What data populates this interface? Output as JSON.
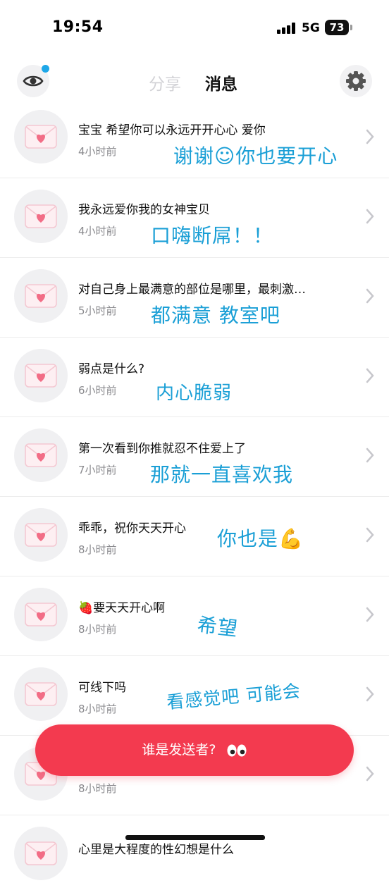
{
  "status_bar": {
    "time": "19:54",
    "network": "5G",
    "battery": "73"
  },
  "header": {
    "tab_share": "分享",
    "tab_messages": "消息"
  },
  "messages": [
    {
      "text": "宝宝 希望你可以永远开开心心 爱你",
      "time": "4小时前",
      "reply": "谢谢☺︎你也要开心"
    },
    {
      "text": "我永远爱你我的女神宝贝",
      "time": "4小时前",
      "reply": "口嗨断屌！！"
    },
    {
      "text": "对自己身上最满意的部位是哪里，最刺激…",
      "time": "5小时前",
      "reply": "都满意 教室吧"
    },
    {
      "text": "弱点是什么?",
      "time": "6小时前",
      "reply": "内心脆弱"
    },
    {
      "text": "第一次看到你推就忍不住爱上了",
      "time": "7小时前",
      "reply": "那就一直喜欢我"
    },
    {
      "text": "乖乖，祝你天天开心",
      "time": "8小时前",
      "reply": "你也是💪"
    },
    {
      "text": "🍓要天天开心啊",
      "time": "8小时前",
      "reply": "希望"
    },
    {
      "text": "可线下吗",
      "time": "8小时前",
      "reply": "看感觉吧 可能会"
    },
    {
      "text": "",
      "time": "8小时前",
      "reply": ""
    },
    {
      "text": "心里是大程度的性幻想是什么",
      "time": "",
      "reply": ""
    }
  ],
  "bottom_button": {
    "label": "谁是发送者?"
  },
  "colors": {
    "accent_red": "#f33a4f",
    "reply_blue": "#1a9fd6",
    "notif_dot": "#1ea7e8"
  },
  "icons": [
    "eye-icon",
    "gear-icon",
    "envelope-heart-icon",
    "chevron-right-icon",
    "eyes-emoji-icon"
  ]
}
